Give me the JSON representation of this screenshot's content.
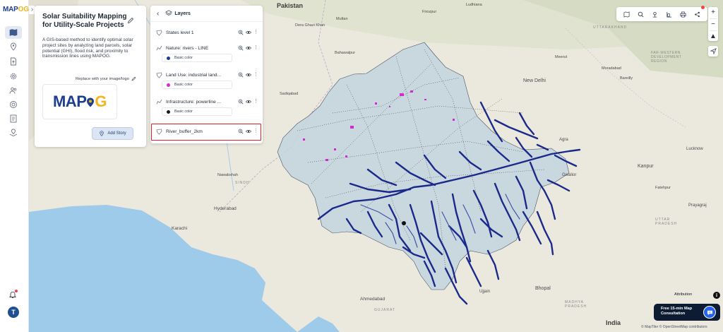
{
  "app": {
    "logo_text": "MAPOG",
    "logo_text_main": "MAP",
    "logo_text_accent": "OG",
    "brand_color": "#1d3f8f",
    "accent_color": "#f2b51e"
  },
  "rail": {
    "items": [
      {
        "icon": "map-icon",
        "active": true
      },
      {
        "icon": "location-pin-icon"
      },
      {
        "icon": "file-upload-icon"
      },
      {
        "icon": "settings-gear-icon"
      },
      {
        "icon": "people-icon"
      },
      {
        "icon": "target-icon"
      },
      {
        "icon": "report-icon"
      },
      {
        "icon": "map-marker-stack-icon"
      }
    ],
    "notification_icon": "bell-icon",
    "avatar_letter": "T"
  },
  "story": {
    "title": "Solar Suitability Mapping for Utility-Scale Projects",
    "description": "A GIS-based method to identify optimal solar project sites by analyzing land parcels, solar potential (GHI), flood risk, and proximity to transmission lines using MAPOG.",
    "replace_logo_label": "Replace with your image/logo",
    "add_story_label": "Add Story"
  },
  "layers": {
    "header": "Layers",
    "items": [
      {
        "name": "States level 1",
        "type": "polygon",
        "has_swatch": false
      },
      {
        "name": "Nature: rivers - LINE",
        "type": "line",
        "has_swatch": true,
        "swatch_label": "Basic color",
        "swatch_color": "#1b3d91"
      },
      {
        "name": "Land Use: industrial land...",
        "type": "polygon",
        "has_swatch": true,
        "swatch_label": "Basic color",
        "swatch_color": "#d42bd1"
      },
      {
        "name": "Infrastructure: powerline ...",
        "type": "line",
        "has_swatch": true,
        "swatch_label": "Basic color",
        "swatch_color": "#1a1a1a"
      },
      {
        "name": "River_buffer_2km",
        "type": "polygon",
        "has_swatch": false,
        "highlighted": true
      }
    ]
  },
  "map": {
    "labels": {
      "pakistan": "Pakistan",
      "dera_ghazi_khan": "Dera Ghazi Khan",
      "multan": "Multan",
      "bahawalpur": "Bahawalpur",
      "sadiqabad": "Sadiqabad",
      "nawabshah": "Nawabshah",
      "sindh": "SINDH",
      "hyderabad": "Hyderabad",
      "karachi": "Karachi",
      "ahmedabad": "Ahmedabad",
      "gujarat": "GUJARAT",
      "ujjain": "Ujjain",
      "bhopal": "Bhopal",
      "india": "India",
      "madhya_pradesh": "MADHYA\nPRADESH",
      "new_delhi": "New Delhi",
      "agra": "Agra",
      "gwalior": "Gwalior",
      "kanpur": "Kanpur",
      "lucknow": "Lucknow",
      "prayagraj": "Prayagraj",
      "uttar_pradesh": "UTTAR\nPRADESH",
      "fatehpur": "Fatehpur",
      "uttarakhand": "UTTARAKHAND",
      "far_western": "FAR-WESTERN\nDEVELOPMENT\nREGION",
      "moradabad": "Moradabad",
      "bareilly": "Bareilly",
      "meerut": "Meerut",
      "ludhiana": "Ludhiana",
      "firozpur": "Firozpur"
    }
  },
  "toolbar": {
    "icons": [
      "map-layer-icon",
      "search-icon",
      "location-icon",
      "measure-icon",
      "print-icon",
      "share-icon"
    ],
    "zoom_in": "+",
    "zoom_out": "−",
    "locate_icon": "navigation-arrow-icon"
  },
  "footer": {
    "attribution_label": "Attribution",
    "consult_label": "Free 15-min Map Consultation",
    "credits": "© MapTiler © OpenStreetMap contributors"
  }
}
